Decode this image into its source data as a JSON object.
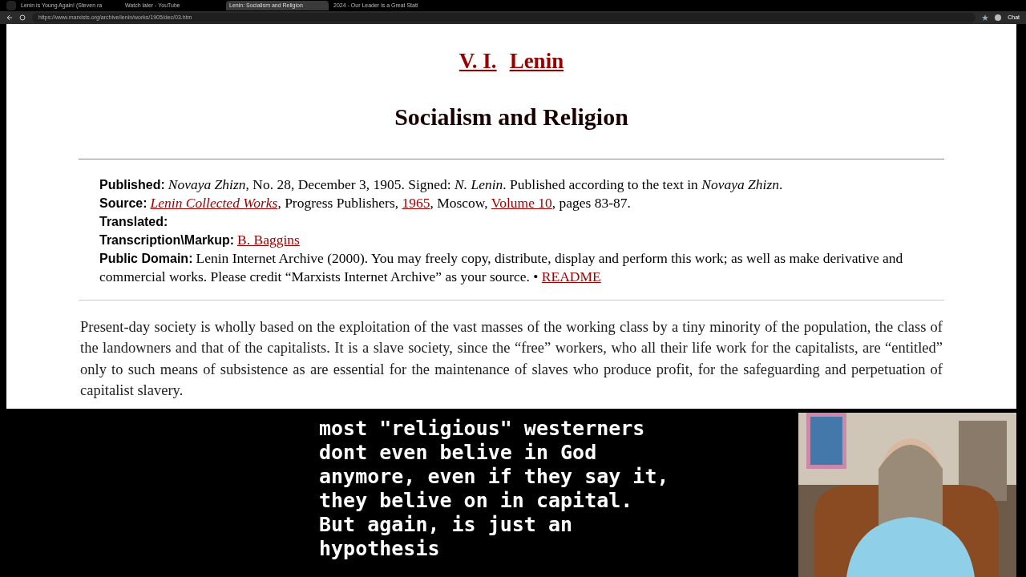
{
  "browser": {
    "tabs": [
      {
        "title": "Lenin is Young Again! (Steven ra",
        "selected": false
      },
      {
        "title": "Watch later - YouTube",
        "selected": false
      },
      {
        "title": "Lenin: Socialism and Religion",
        "selected": true
      },
      {
        "title": "2024 - Our Leader is a Great Stati",
        "selected": false
      }
    ],
    "address": "https://www.marxists.org/archive/lenin/works/1905/dec/03.htm",
    "chat_button": "Chat"
  },
  "page": {
    "author": [
      "V. I.",
      "Lenin"
    ],
    "title": "Socialism and Religion",
    "info": [
      {
        "label": "Published:",
        "text": "*Novaya Zhizn*, No. 28, December 3, 1905. Signed: *N. Lenin*. Published according to the text in *Novaya Zhizn*."
      },
      {
        "label": "Source:",
        "parts": [
          {
            "text": "Lenin Collected Works",
            "kind": "italic_link"
          },
          {
            "text": ", Progress Publishers, ",
            "kind": "text"
          },
          {
            "text": "1965",
            "kind": "link"
          },
          {
            "text": ", Moscow, ",
            "kind": "text"
          },
          {
            "text": "Volume 10",
            "kind": "link"
          },
          {
            "text": ", pages 83-87.",
            "kind": "text"
          }
        ]
      },
      {
        "label": "Translated:"
      },
      {
        "label": "Transcription\\Markup:",
        "parts": [
          {
            "text": "B. Baggins",
            "kind": "link"
          }
        ]
      },
      {
        "label": "Public Domain:",
        "parts": [
          {
            "text": "Lenin Internet Archive (2000). You may freely copy, distribute, display and perform this work; as well as make derivative and commercial works. Please credit “Marxists Internet Archive” as your source. • ",
            "kind": "text"
          },
          {
            "text": "README",
            "kind": "link"
          }
        ]
      }
    ],
    "body": "Present-day society is wholly based on the exploitation of the vast masses of the working class by a tiny minority of the population, the class of the landowners and that of the capitalists. It is a slave society, since the “free” workers, who all their life work for the capitalists, are “entitled” only to such means of subsistence as are essential for the maintenance of slaves who produce profit, for the safeguarding and perpetuation of capitalist slavery."
  },
  "chat": {
    "lines": [
      "most \"religious\" westerners",
      "dont even belive in God",
      "anymore, even if they say it,",
      "they belive on in capital.",
      "But again, is just an",
      "hypothesis"
    ]
  }
}
